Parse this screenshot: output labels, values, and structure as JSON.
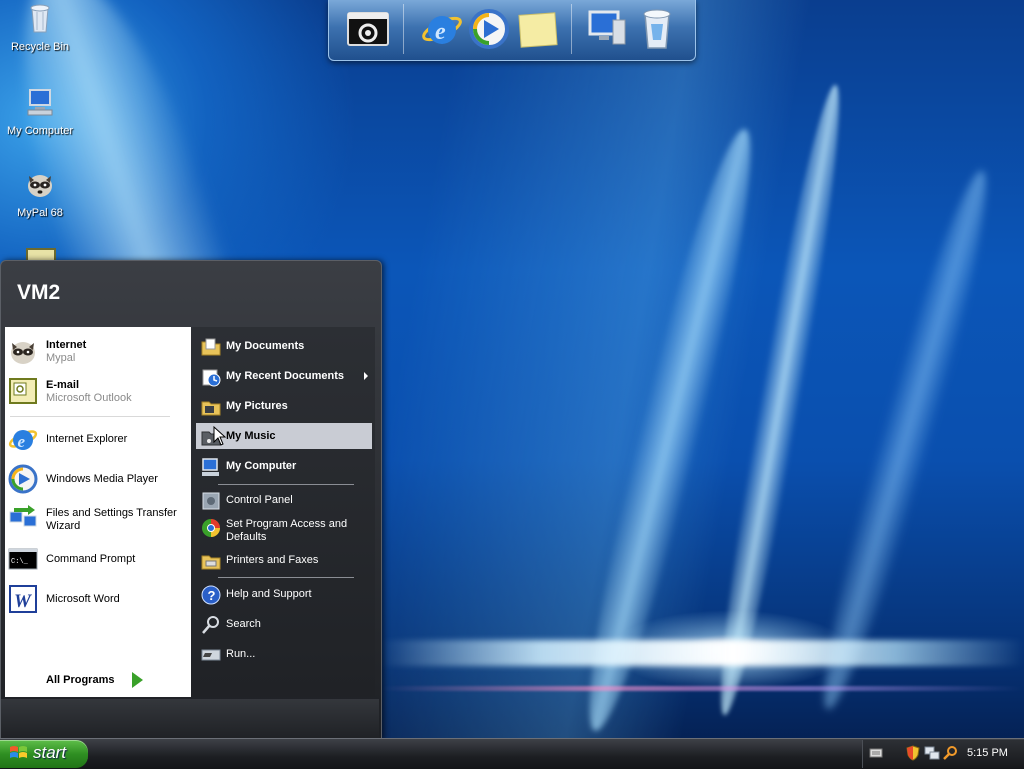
{
  "desktop": {
    "icons": [
      {
        "label": "Recycle Bin"
      },
      {
        "label": "My Computer"
      },
      {
        "label": "MyPal 68"
      }
    ]
  },
  "dock": {
    "items": [
      {
        "icon": "settings-terminal-icon"
      },
      {
        "icon": "internet-explorer-icon"
      },
      {
        "icon": "media-player-icon"
      },
      {
        "icon": "sticky-note-icon"
      },
      {
        "icon": "my-computer-icon"
      },
      {
        "icon": "recycle-bin-icon"
      }
    ]
  },
  "start_menu": {
    "user": "VM2",
    "pinned": [
      {
        "title": "Internet",
        "subtitle": "Mypal"
      },
      {
        "title": "E-mail",
        "subtitle": "Microsoft Outlook"
      }
    ],
    "recent": [
      {
        "label": "Internet Explorer"
      },
      {
        "label": "Windows Media Player"
      },
      {
        "label": "Files and Settings Transfer Wizard"
      },
      {
        "label": "Command Prompt"
      },
      {
        "label": "Microsoft Word"
      }
    ],
    "all_programs": "All Programs",
    "right": {
      "my_documents": "My Documents",
      "my_recent_documents": "My Recent Documents",
      "my_pictures": "My Pictures",
      "my_music": "My Music",
      "my_computer": "My Computer",
      "control_panel": "Control Panel",
      "set_program_access": "Set Program Access and Defaults",
      "printers_faxes": "Printers and Faxes",
      "help_support": "Help and Support",
      "search": "Search",
      "run": "Run..."
    }
  },
  "taskbar": {
    "start_label": "start",
    "clock": "5:15 PM"
  },
  "colors": {
    "accent_green": "#2f8f22",
    "menu_dark": "#2c2f34",
    "hover": "#c9ccd4"
  }
}
